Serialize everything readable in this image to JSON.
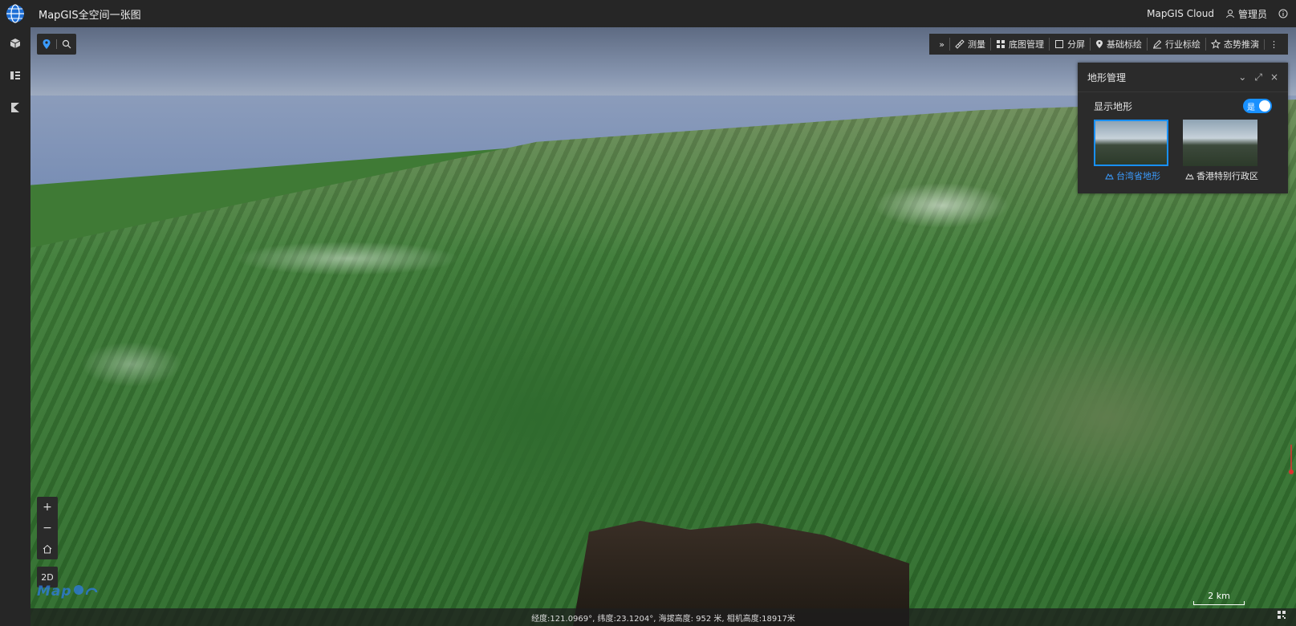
{
  "app": {
    "title": "MapGIS全空间一张图",
    "cloud_label": "MapGIS Cloud",
    "user_label": "管理员"
  },
  "toolbar": {
    "items": [
      {
        "label": "测量",
        "icon": "ruler-icon"
      },
      {
        "label": "底图管理",
        "icon": "grid-icon"
      },
      {
        "label": "分屏",
        "icon": "square-icon"
      },
      {
        "label": "基础标绘",
        "icon": "pin-icon"
      },
      {
        "label": "行业标绘",
        "icon": "pen-icon"
      },
      {
        "label": "态势推演",
        "icon": "star-icon"
      }
    ]
  },
  "terrain_panel": {
    "title": "地形管理",
    "show_label": "显示地形",
    "toggle_text": "是",
    "toggle_on": true,
    "cards": [
      {
        "label": "台湾省地形",
        "selected": true
      },
      {
        "label": "香港特别行政区",
        "selected": false
      }
    ]
  },
  "controls": {
    "zoom_in": "+",
    "zoom_out": "−",
    "mode_2d": "2D"
  },
  "status": {
    "text": "经度:121.0969°, 纬度:23.1204°, 海拔高度: 952 米, 相机高度:18917米"
  },
  "scale": {
    "label": "2 km"
  },
  "colors": {
    "accent": "#1890ff",
    "bar_bg": "#262626"
  }
}
